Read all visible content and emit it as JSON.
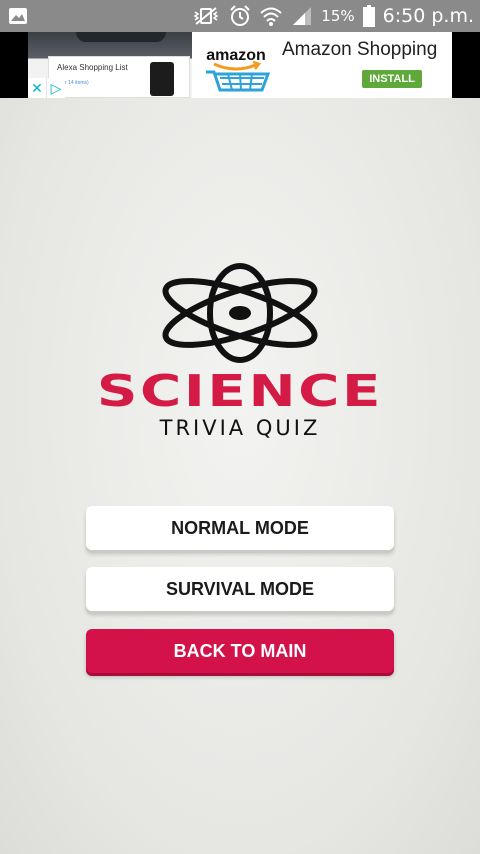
{
  "status_bar": {
    "battery_percent": "15%",
    "time": "6:50 p.m.",
    "icons": [
      "gallery-icon",
      "mute-vibrate-icon",
      "alarm-icon",
      "wifi-icon",
      "signal-icon",
      "battery-icon"
    ]
  },
  "ad": {
    "thumb_text": "Alexa Shopping List",
    "thumb_subtext": "your 14 items)",
    "logo_text": "amazon",
    "title": "Amazon Shopping",
    "install_label": "INSTALL",
    "install_color": "#5fa83a",
    "close_glyph": "✕",
    "info_glyph": "▷"
  },
  "logo": {
    "title": "SCIENCE",
    "subtitle": "TRIVIA QUIZ",
    "title_color": "#d41b46"
  },
  "menu": {
    "normal_mode": "NORMAL MODE",
    "survival_mode": "SURVIVAL MODE",
    "back_to_main": "BACK TO MAIN",
    "accent_color": "#d3124a"
  }
}
